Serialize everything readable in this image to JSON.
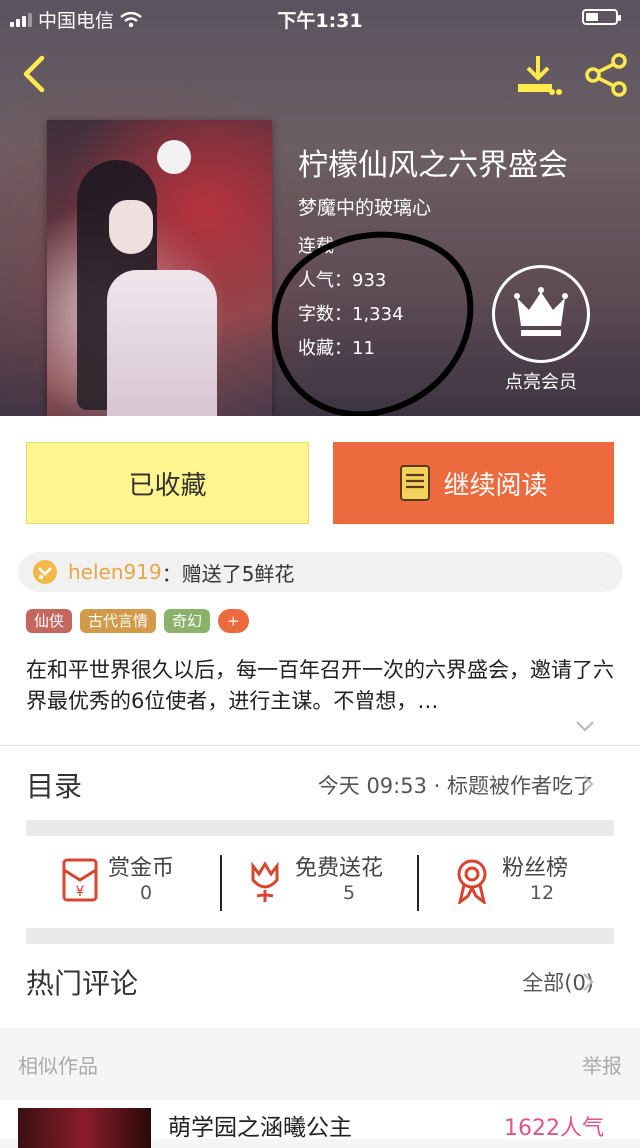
{
  "status_bar": {
    "carrier": "中国电信",
    "time": "下午1:31"
  },
  "book": {
    "title": "柠檬仙风之六界盛会",
    "author": "梦魔中的玻璃心",
    "status": "连载",
    "popularity": "人气：933",
    "word_count": "字数：1,334",
    "favorites": "收藏：11"
  },
  "vip": {
    "label": "点亮会员"
  },
  "actions": {
    "collected": "已收藏",
    "continue_reading": "继续阅读"
  },
  "gift": {
    "user": "helen919",
    "text": "：赠送了5鲜花"
  },
  "tags": [
    {
      "label": "仙侠",
      "color": "#c4685f"
    },
    {
      "label": "古代言情",
      "color": "#d39a4a"
    },
    {
      "label": "奇幻",
      "color": "#8bb26a"
    },
    {
      "label": "+",
      "color": "#ec6a3d"
    }
  ],
  "description": "在和平世界很久以后，每一百年召开一次的六界盛会，邀请了六界最优秀的6位使者，进行主谋。不曾想，…",
  "catalog": {
    "title": "目录",
    "latest": "今天 09:53 · 标题被作者吃了"
  },
  "metrics": [
    {
      "label": "赏金币",
      "value": "0"
    },
    {
      "label": "免费送花",
      "value": "5"
    },
    {
      "label": "粉丝榜",
      "value": "12"
    }
  ],
  "comments": {
    "title": "热门评论",
    "all": "全部(0)"
  },
  "similar": {
    "title": "相似作品",
    "report": "举报"
  },
  "similar_item": {
    "title": "萌学园之涵曦公主",
    "popularity": "1622人气"
  },
  "colors": {
    "accent": "#ec6a3d",
    "collect_bg": "#fff68f",
    "gift_user": "#e8a546",
    "popularity_pink": "#e0558a"
  }
}
